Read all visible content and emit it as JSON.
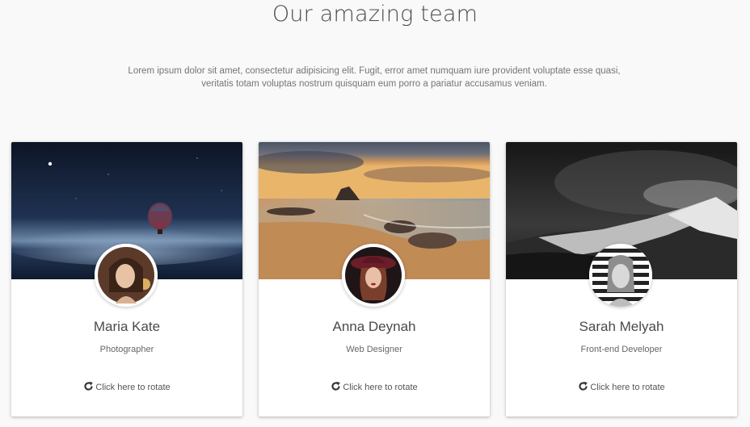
{
  "header": {
    "title": "Our amazing team",
    "lead": "Lorem ipsum dolor sit amet, consectetur adipisicing elit. Fugit, error amet numquam iure provident voluptate esse quasi, veritatis totam voluptas nostrum quisquam eum porro a pariatur accusamus veniam."
  },
  "cards": [
    {
      "name": "Maria Kate",
      "role": "Photographer",
      "rotate_label": "Click here to rotate",
      "cover_icon": "night-sky-balloon-image",
      "avatar_icon": "avatar-photo"
    },
    {
      "name": "Anna Deynah",
      "role": "Web Designer",
      "rotate_label": "Click here to rotate",
      "cover_icon": "beach-sunset-image",
      "avatar_icon": "avatar-photo"
    },
    {
      "name": "Sarah Melyah",
      "role": "Front-end Developer",
      "rotate_label": "Click here to rotate",
      "cover_icon": "snowy-mountain-image",
      "avatar_icon": "avatar-photo"
    }
  ],
  "icons": {
    "rotate": "rotate-icon"
  },
  "colors": {
    "background": "#f9f9f9",
    "card": "#ffffff",
    "title_text": "#4a4a4a",
    "body_text": "#757575"
  }
}
